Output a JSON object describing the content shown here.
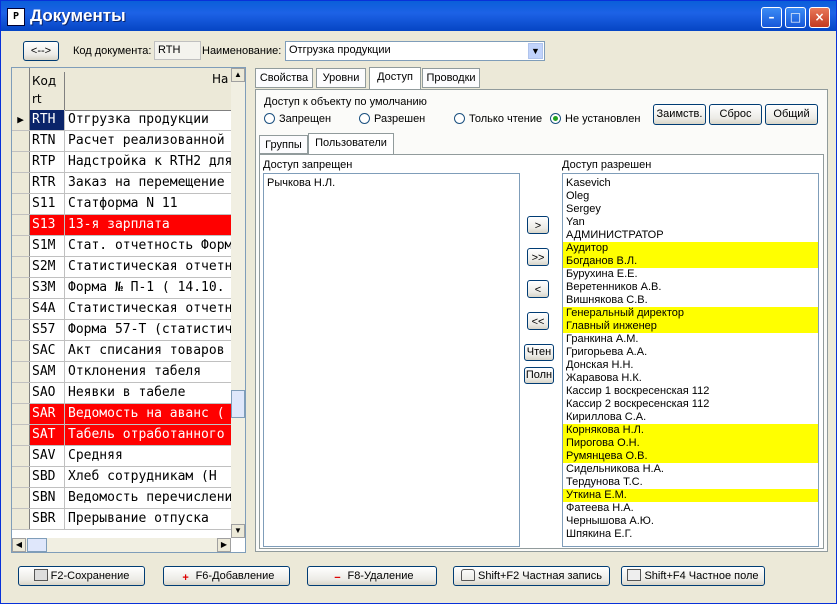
{
  "window": {
    "title": "Документы",
    "app_icon_text": "P"
  },
  "toolbar": {
    "swap_label": "<-->",
    "code_label": "Код документа:",
    "code_value": "RTH",
    "name_label": "Наименование:",
    "name_value": "Отгрузка продукции"
  },
  "grid": {
    "header_code": "Код\nrt",
    "header_code_l1": "Код",
    "header_code_l2": "rt",
    "header_name": "На",
    "rows": [
      {
        "code": "RTH",
        "name": "Отгрузка продукции",
        "style": "sel"
      },
      {
        "code": "RTN",
        "name": "Расчет реализованной",
        "style": ""
      },
      {
        "code": "RTP",
        "name": "Надстройка к RTH2 для",
        "style": ""
      },
      {
        "code": "RTR",
        "name": "Заказ на перемещение",
        "style": ""
      },
      {
        "code": "S11",
        "name": "Статформа N 11",
        "style": ""
      },
      {
        "code": "S13",
        "name": "13-я зарплата",
        "style": "red"
      },
      {
        "code": "S1M",
        "name": "Стат. отчетность Форма",
        "style": ""
      },
      {
        "code": "S2M",
        "name": "Статистическая отчетн",
        "style": ""
      },
      {
        "code": "S3M",
        "name": "Форма № П-1 ( 14.10.",
        "style": ""
      },
      {
        "code": "S4A",
        "name": "Статистическая отчетн",
        "style": ""
      },
      {
        "code": "S57",
        "name": "Форма 57-Т (статистич",
        "style": ""
      },
      {
        "code": "SAC",
        "name": "Акт списания товаров",
        "style": ""
      },
      {
        "code": "SAM",
        "name": "Отклонения табеля",
        "style": ""
      },
      {
        "code": "SAO",
        "name": "Неявки в табеле",
        "style": ""
      },
      {
        "code": "SAR",
        "name": "Ведомость на аванс (",
        "style": "red"
      },
      {
        "code": "SAT",
        "name": "Табель отработанного",
        "style": "red"
      },
      {
        "code": "SAV",
        "name": "Средняя",
        "style": ""
      },
      {
        "code": "SBD",
        "name": "Хлеб сотрудникам (Н",
        "style": ""
      },
      {
        "code": "SBN",
        "name": "Ведомость перечислени",
        "style": ""
      },
      {
        "code": "SBR",
        "name": "Прерывание отпуска",
        "style": ""
      }
    ]
  },
  "tabs": [
    "Свойства",
    "Уровни",
    "Доступ",
    "Проводки"
  ],
  "active_tab": "Доступ",
  "access": {
    "group_title": "Доступ к объекту по умолчанию",
    "radios": [
      {
        "label": "Запрещен",
        "checked": false
      },
      {
        "label": "Разрешен",
        "checked": false
      },
      {
        "label": "Только чтение",
        "checked": false
      },
      {
        "label": "Не установлен",
        "checked": true
      }
    ],
    "btn_borrow": "Заимств.",
    "btn_reset": "Сброс",
    "btn_common": "Общий"
  },
  "subtabs": [
    "Группы",
    "Пользователи"
  ],
  "denied": {
    "title": "Доступ запрещен",
    "items": [
      "Рычкова Н.Л."
    ]
  },
  "transfer": {
    "one": ">",
    "all": ">>",
    "back_one": "<",
    "back_all": "<<",
    "read": "Чтен",
    "full": "Полн"
  },
  "allowed": {
    "title": "Доступ разрешен",
    "items": [
      {
        "t": "Kasevich",
        "h": false
      },
      {
        "t": "Oleg",
        "h": false
      },
      {
        "t": "Sergey",
        "h": false
      },
      {
        "t": "Yan",
        "h": false
      },
      {
        "t": "АДМИНИСТРАТОР",
        "h": false
      },
      {
        "t": "Аудитор",
        "h": true
      },
      {
        "t": "Богданов В.Л.",
        "h": true
      },
      {
        "t": "Бурухина Е.Е.",
        "h": false
      },
      {
        "t": "Веретенников А.В.",
        "h": false
      },
      {
        "t": "Вишнякова С.В.",
        "h": false
      },
      {
        "t": "Генеральный директор",
        "h": true
      },
      {
        "t": "Главный инженер",
        "h": true
      },
      {
        "t": "Гранкина А.М.",
        "h": false
      },
      {
        "t": "Григорьева А.А.",
        "h": false
      },
      {
        "t": "Донская Н.Н.",
        "h": false
      },
      {
        "t": "Жаравова Н.К.",
        "h": false
      },
      {
        "t": "Кассир 1 воскресенская 112",
        "h": false
      },
      {
        "t": "Кассир 2 воскресенская 112",
        "h": false
      },
      {
        "t": "Кириллова С.А.",
        "h": false
      },
      {
        "t": "Корнякова Н.Л.",
        "h": true
      },
      {
        "t": "Пирогова О.Н.",
        "h": true
      },
      {
        "t": "Румянцева О.В.",
        "h": true
      },
      {
        "t": "Сидельникова Н.А.",
        "h": false
      },
      {
        "t": "Тердунова Т.С.",
        "h": false
      },
      {
        "t": "Уткина Е.М.",
        "h": true
      },
      {
        "t": "Фатеева Н.А.",
        "h": false
      },
      {
        "t": "Чернышова А.Ю.",
        "h": false
      },
      {
        "t": "Шпякина Е.Г.",
        "h": false
      }
    ]
  },
  "footer": {
    "save": "F2-Сохранение",
    "add": "F6-Добавление",
    "delete": "F8-Удаление",
    "private_record": "Shift+F2 Частная запись",
    "private_field": "Shift+F4 Частное поле"
  },
  "colors": {
    "title_bar": "#0a5fd9",
    "red_row": "#ff0000",
    "yellow_highlight": "#ffff00",
    "selection": "#0a246a"
  }
}
